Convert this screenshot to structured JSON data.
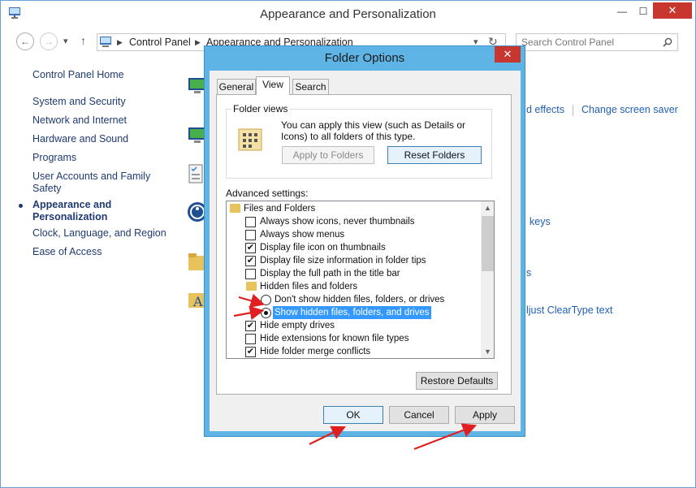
{
  "window": {
    "title": "Appearance and Personalization",
    "minimize": "—",
    "maximize": "☐",
    "close": "✕"
  },
  "nav": {
    "back": "←",
    "forward": "→",
    "recent": "▾",
    "up": "↑",
    "breadcrumb": [
      "Control Panel",
      "Appearance and Personalization"
    ],
    "dropdown": "▾",
    "refresh": "↻",
    "search_placeholder": "Search Control Panel"
  },
  "sidebar": {
    "items": [
      {
        "label": "Control Panel Home"
      },
      {
        "label": "System and Security"
      },
      {
        "label": "Network and Internet"
      },
      {
        "label": "Hardware and Sound"
      },
      {
        "label": "Programs"
      },
      {
        "label": "User Accounts and Family"
      },
      {
        "label": "Safety"
      },
      {
        "label": "Appearance and"
      },
      {
        "label": "Personalization"
      },
      {
        "label": "Clock, Language, and Region"
      },
      {
        "label": "Ease of Access"
      }
    ]
  },
  "main": {
    "visible_links": [
      "d effects",
      "Change screen saver",
      "keys",
      "s",
      "ljust ClearType text"
    ]
  },
  "dialog": {
    "title": "Folder Options",
    "close": "✕",
    "tabs": [
      "General",
      "View",
      "Search"
    ],
    "selected_tab": "View",
    "folder_views": {
      "group_label": "Folder views",
      "description": "You can apply this view (such as Details or Icons) to all folders of this type.",
      "apply_to_folders": "Apply to Folders",
      "reset_folders": "Reset Folders"
    },
    "advanced_label": "Advanced settings:",
    "advanced_items": [
      {
        "kind": "folder",
        "label": "Files and Folders"
      },
      {
        "kind": "checkbox",
        "checked": false,
        "label": "Always show icons, never thumbnails"
      },
      {
        "kind": "checkbox",
        "checked": false,
        "label": "Always show menus"
      },
      {
        "kind": "checkbox",
        "checked": true,
        "label": "Display file icon on thumbnails"
      },
      {
        "kind": "checkbox",
        "checked": true,
        "label": "Display file size information in folder tips"
      },
      {
        "kind": "checkbox",
        "checked": false,
        "label": "Display the full path in the title bar"
      },
      {
        "kind": "folder",
        "label": "Hidden files and folders"
      },
      {
        "kind": "radio",
        "checked": false,
        "label": "Don't show hidden files, folders, or drives"
      },
      {
        "kind": "radio",
        "checked": true,
        "label": "Show hidden files, folders, and drives"
      },
      {
        "kind": "checkbox",
        "checked": true,
        "label": "Hide empty drives"
      },
      {
        "kind": "checkbox",
        "checked": false,
        "label": "Hide extensions for known file types"
      },
      {
        "kind": "checkbox",
        "checked": true,
        "label": "Hide folder merge conflicts"
      }
    ],
    "restore_defaults": "Restore Defaults",
    "ok": "OK",
    "cancel": "Cancel",
    "apply": "Apply",
    "scroll_up": "▲",
    "scroll_down": "▼"
  },
  "colors": {
    "dialog_frame": "#5eb4e5",
    "close_red": "#c7372f",
    "selection_blue": "#3399ff",
    "link_blue": "#1f5fb5",
    "annotation_red": "#e02020"
  }
}
